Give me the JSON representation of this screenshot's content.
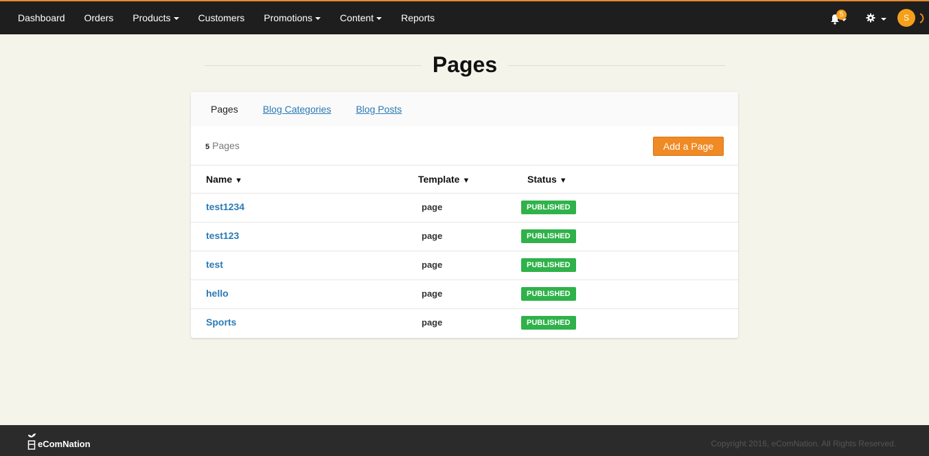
{
  "nav": {
    "items": [
      {
        "label": "Dashboard",
        "dropdown": false
      },
      {
        "label": "Orders",
        "dropdown": false
      },
      {
        "label": "Products",
        "dropdown": true
      },
      {
        "label": "Customers",
        "dropdown": false
      },
      {
        "label": "Promotions",
        "dropdown": true
      },
      {
        "label": "Content",
        "dropdown": true
      },
      {
        "label": "Reports",
        "dropdown": false
      }
    ],
    "notification_count": "5",
    "avatar_initial": "S"
  },
  "page": {
    "title": "Pages"
  },
  "tabs": [
    {
      "label": "Pages",
      "active": true
    },
    {
      "label": "Blog Categories",
      "active": false
    },
    {
      "label": "Blog Posts",
      "active": false
    }
  ],
  "toolbar": {
    "count": "5",
    "count_label": "Pages",
    "add_label": "Add a Page"
  },
  "table": {
    "columns": [
      {
        "label": "Name",
        "sort_glyph": "▼"
      },
      {
        "label": "Template",
        "sort_glyph": "▼"
      },
      {
        "label": "Status",
        "sort_glyph": "▼"
      }
    ],
    "rows": [
      {
        "name": "test1234",
        "template": "page",
        "status": "PUBLISHED"
      },
      {
        "name": "test123",
        "template": "page",
        "status": "PUBLISHED"
      },
      {
        "name": "test",
        "template": "page",
        "status": "PUBLISHED"
      },
      {
        "name": "hello",
        "template": "page",
        "status": "PUBLISHED"
      },
      {
        "name": "Sports",
        "template": "page",
        "status": "PUBLISHED"
      }
    ]
  },
  "footer": {
    "brand": "eComNation",
    "copyright": "Copyright 2016, eComNation. All Rights Reserved."
  },
  "colors": {
    "accent": "#f08a24",
    "link": "#2a7ab6",
    "published": "#2fb24a",
    "topbar": "#1e1e1e",
    "background": "#f5f4ea"
  },
  "icons": [
    "bell-icon",
    "gear-icon",
    "spinner-icon",
    "caret-down-icon",
    "sprout-logo-icon"
  ]
}
